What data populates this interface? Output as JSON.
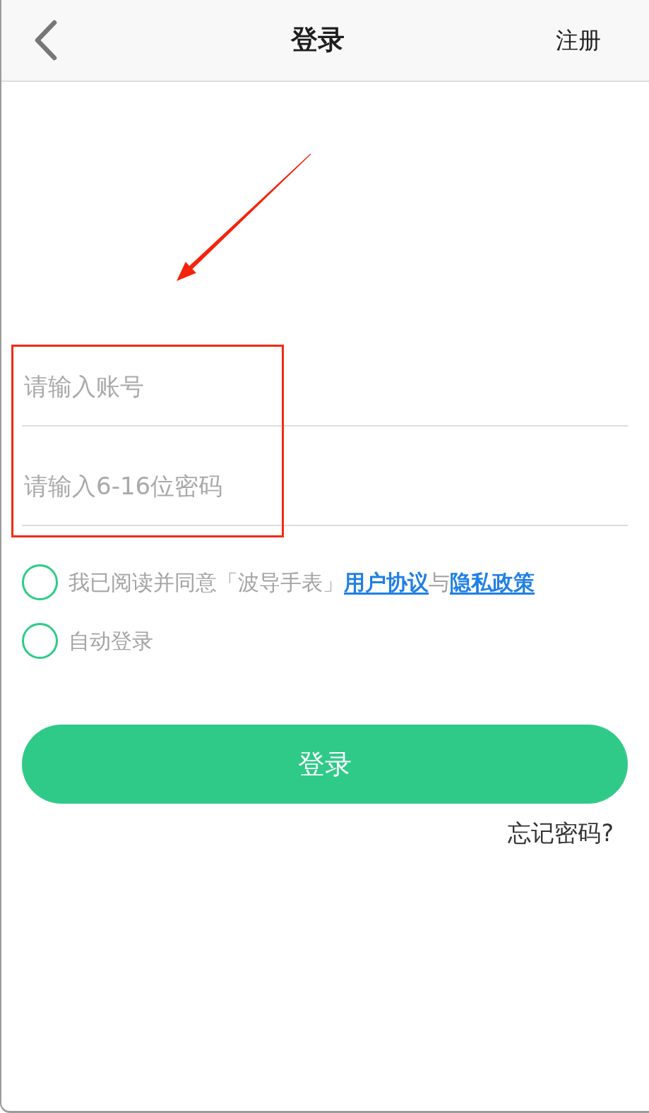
{
  "header": {
    "title": "登录",
    "action": "注册"
  },
  "fields": [
    {
      "placeholder": "请输入账号"
    },
    {
      "placeholder": "请输入6-16位密码"
    }
  ],
  "options": [
    {
      "checked": false,
      "segments": [
        {
          "kind": "text",
          "text": "我已阅读并同意「波导手表」"
        },
        {
          "kind": "link",
          "text": "用户协议"
        },
        {
          "kind": "text",
          "text": "与"
        },
        {
          "kind": "link",
          "text": "隐私政策"
        }
      ]
    },
    {
      "checked": false,
      "segments": [
        {
          "kind": "text",
          "text": "自动登录"
        }
      ]
    }
  ],
  "submit_button": "登录",
  "forgot_link": "忘记密码?",
  "annotations": {
    "arrow": true,
    "highlight_frame": true
  }
}
